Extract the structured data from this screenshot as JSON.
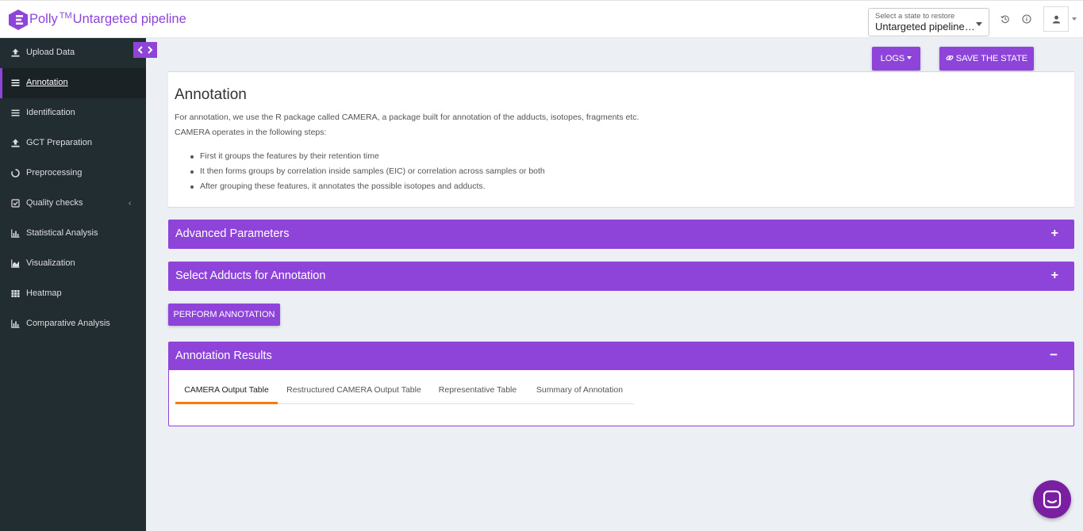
{
  "header": {
    "brand_name": "Polly",
    "brand_mark": "TM",
    "pipeline_name": "Untargeted pipeline",
    "state_select": {
      "label": "Select a state to restore",
      "value": "Untargeted pipeline ..."
    }
  },
  "sidebar": {
    "items": [
      {
        "label": "Upload Data",
        "icon": "upload-icon",
        "active": false
      },
      {
        "label": "Annotation",
        "icon": "list-icon",
        "active": true
      },
      {
        "label": "Identification",
        "icon": "list-icon",
        "active": false
      },
      {
        "label": "GCT Preparation",
        "icon": "upload-icon",
        "active": false
      },
      {
        "label": "Preprocessing",
        "icon": "circle-icon",
        "active": false
      },
      {
        "label": "Quality checks",
        "icon": "checkbox-icon",
        "active": false
      },
      {
        "label": "Statistical Analysis",
        "icon": "bar-chart-icon",
        "active": false
      },
      {
        "label": "Visualization",
        "icon": "area-chart-icon",
        "active": false
      },
      {
        "label": "Heatmap",
        "icon": "grid-icon",
        "active": false
      },
      {
        "label": "Comparative Analysis",
        "icon": "bar-chart-icon",
        "active": false
      }
    ]
  },
  "toolbar": {
    "logs_label": "LOGS",
    "save_label": "SAVE THE STATE"
  },
  "annotation": {
    "title": "Annotation",
    "intro": "For annotation, we use the R package called CAMERA, a package built for annotation of the adducts, isotopes, fragments etc.",
    "steps_intro": "CAMERA operates in the following steps:",
    "steps": [
      "First it groups the features by their retention time",
      "It then forms groups by correlation inside samples (EIC) or correlation across samples or both",
      "After grouping these features, it annotates the possible isotopes and adducts."
    ]
  },
  "panels": {
    "advanced": {
      "title": "Advanced Parameters",
      "toggle": "+"
    },
    "adducts": {
      "title": "Select Adducts for Annotation",
      "toggle": "+"
    }
  },
  "perform_label": "PERFORM ANNOTATION",
  "results": {
    "title": "Annotation Results",
    "toggle": "−",
    "tabs": [
      {
        "label": "CAMERA Output Table",
        "active": true
      },
      {
        "label": "Restructured CAMERA Output Table",
        "active": false
      },
      {
        "label": "Representative Table",
        "active": false
      },
      {
        "label": "Summary of Annotation",
        "active": false
      }
    ]
  },
  "colors": {
    "accent": "#8e44d9",
    "sidebar_bg": "#222d32",
    "tab_indicator": "#f57c00",
    "chat": "#7b1fa2"
  }
}
